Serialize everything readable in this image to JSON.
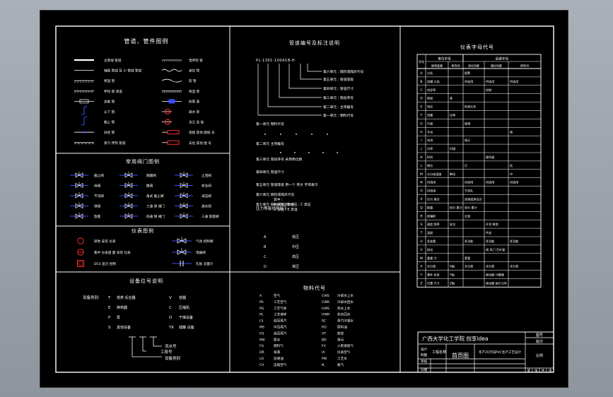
{
  "panel_pipe_symbols": {
    "title": "管道、管件图例",
    "left": [
      "主管线 管道",
      "辅助 管线 及 小 管线 管道",
      "保温 管",
      "伴热 管 保温",
      "夹套 管",
      "从下 管",
      "朝上 管",
      "异径 管",
      "蒸汽 伴热 管道"
    ],
    "right": [
      "电伴热 管",
      "波纹 管",
      "软 管",
      "保温 管",
      "防雨 罩",
      "疏水 管",
      "法兰 盲 板",
      "连接 其他 图纸 号",
      "去往 其他 图 号"
    ]
  },
  "panel_valves": {
    "title": "常用阀门图例",
    "col1": [
      "截止阀",
      "闸阀",
      "节流阀",
      "球阀",
      "旋塞"
    ],
    "col2": [
      "隔膜阀",
      "蝶阀",
      "角式 截止阀",
      "三通 球 阀门",
      "四通 球 阀门"
    ],
    "col3": [
      "止回阀",
      "安全阀",
      "减压阀",
      "疏水阀",
      "三通 旋塞阀"
    ]
  },
  "panel_instruments": {
    "title": "仪表图例",
    "left": [
      "就地 安装 仪表",
      "集中 仪表盘 面 安装 仪表",
      "DCS 显示 控制"
    ],
    "right": [
      "气动 控制阀",
      "电磁阀",
      "孔板 流量计"
    ]
  },
  "panel_equipment_code": {
    "title": "设备位号说明",
    "left": [
      "塔类 反应器",
      "换热器",
      "泵",
      "其他设备"
    ],
    "left_marks": [
      "T",
      "E",
      "P",
      "S"
    ],
    "right": [
      "容器",
      "压缩机",
      "干燥设备",
      "储罐 设备"
    ],
    "right_marks": [
      "V",
      "C",
      "D",
      "TK"
    ],
    "prefix": "设备类别:",
    "tree_labels": [
      "流水号",
      "工段号",
      "设备类别"
    ]
  },
  "panel_pipe_code": {
    "title": "管道编号及标注说明",
    "code_string": "PL-1301-100A1B-H",
    "callouts": [
      "第六单元 : 隔热或隔声代号",
      "第五单元 : 管道等级",
      "第四单元 : 管道尺寸",
      "第三单元 : 管段序号",
      "第二单元 : 主项编号",
      "第一单元 : 物料代号"
    ],
    "notes": [
      "第一单元 物料代号",
      "第二单元 主项编号",
      "第三单元 管段序号 采用两位数",
      "第四单元 管道尺寸",
      "第五单元 管道等级 用一个 英文 字母表示",
      "第六单元 隔热或隔声代号",
      "第七单元 隔热或隔声类型",
      "其中 :",
      "A 低压 ; B 中压 ; C 高压",
      "D 常温 ; E 高温"
    ],
    "legend_title": "压力等级代号如下:",
    "legend_keys": [
      "A",
      "B",
      "C",
      "D"
    ],
    "legend_vals": [
      "低压",
      "中压",
      "高压",
      "常压"
    ]
  },
  "panel_materials": {
    "title": "物料代号",
    "codes_left": [
      "A",
      "PA",
      "PG",
      "PL",
      "LS",
      "MS",
      "HS",
      "RW",
      "FG",
      "DR",
      "LO",
      "CA"
    ],
    "names_left": [
      "空气",
      "工艺空气",
      "工艺气体",
      "工艺液体",
      "低压蒸汽",
      "中压蒸汽",
      "高压蒸汽",
      "原水",
      "燃料气",
      "排液",
      "润滑油",
      "压缩空气"
    ],
    "codes_right": [
      "CWS",
      "CWR",
      "HWS",
      "HWR",
      "SC",
      "RO",
      "VT",
      "BD",
      "FV",
      "IA",
      "PW",
      "N"
    ],
    "names_right": [
      "冷却水上水",
      "冷却水回水",
      "热水上水",
      "热水回水",
      "蒸汽冷凝水",
      "原料油",
      "放空",
      "排污",
      "火炬排放气",
      "仪表空气",
      "工艺水",
      "氮气"
    ]
  },
  "panel_instrument_codes": {
    "title": "仪表字母代号",
    "header_group1": "首位字母",
    "header_group2": "后继字母",
    "header_cols": [
      "字母",
      "被测变量",
      "修饰词",
      "读出功能",
      "输出功能",
      "修饰词"
    ],
    "rows": [
      [
        "A",
        "分析",
        "",
        "报警",
        "",
        ""
      ],
      [
        "B",
        "烧嘴 火焰",
        "",
        "供选用",
        "供选用",
        "供选用"
      ],
      [
        "C",
        "电导率",
        "",
        "",
        "控制",
        ""
      ],
      [
        "D",
        "密度",
        "差",
        "",
        "",
        ""
      ],
      [
        "E",
        "电压",
        "",
        "检测元件",
        "",
        ""
      ],
      [
        "F",
        "流量",
        "比率",
        "",
        "",
        ""
      ],
      [
        "G",
        "尺度",
        "",
        "玻璃",
        "",
        ""
      ],
      [
        "H",
        "手动",
        "",
        "",
        "",
        "高"
      ],
      [
        "I",
        "电流",
        "",
        "指示",
        "",
        ""
      ],
      [
        "J",
        "功率",
        "扫描",
        "",
        "",
        ""
      ],
      [
        "K",
        "时间",
        "",
        "",
        "操作器",
        ""
      ],
      [
        "L",
        "物位",
        "",
        "灯",
        "",
        "低"
      ],
      [
        "M",
        "水分或湿度",
        "瞬动",
        "",
        "",
        "中"
      ],
      [
        "N",
        "供选用",
        "",
        "供选用",
        "供选用",
        "供选用"
      ],
      [
        "O",
        "供选用",
        "",
        "节流孔",
        "",
        ""
      ],
      [
        "P",
        "压力 真空",
        "",
        "连接或测试点",
        "",
        ""
      ],
      [
        "Q",
        "数量",
        "积分 累计",
        "积分 累计",
        "",
        ""
      ],
      [
        "R",
        "核辐射",
        "",
        "记录",
        "",
        ""
      ],
      [
        "S",
        "速度 频率",
        "安全",
        "",
        "开关 联锁",
        ""
      ],
      [
        "T",
        "温度",
        "",
        "",
        "传送",
        ""
      ],
      [
        "U",
        "多变量",
        "",
        "多功能",
        "多功能",
        "多功能"
      ],
      [
        "V",
        "振动",
        "",
        "",
        "阀 风门 百叶窗",
        ""
      ],
      [
        "W",
        "重量 力",
        "",
        "套管",
        "",
        ""
      ],
      [
        "X",
        "未分类",
        "X轴",
        "未分类",
        "未分类",
        "未分类"
      ],
      [
        "Y",
        "事件 状态",
        "Y轴",
        "",
        "继动器 计算器",
        ""
      ],
      [
        "Z",
        "位置 尺寸",
        "Z轴",
        "",
        "驱动器 执行元件",
        ""
      ]
    ]
  },
  "title_block": {
    "school": "广西大学化工学院  创享idea",
    "drawing_title": "首页图",
    "scale_label": "比例",
    "project_label": "工程名称",
    "left_labels": [
      "设计",
      "制图",
      "审核",
      "日期"
    ],
    "left_values": [
      "",
      "",
      "",
      ""
    ],
    "right_top": [
      "图号",
      "版次"
    ],
    "description": "年产20万吨PVC生产工艺设计",
    "sheet_label": "第 1 张",
    "total_label": "共 1 张"
  }
}
